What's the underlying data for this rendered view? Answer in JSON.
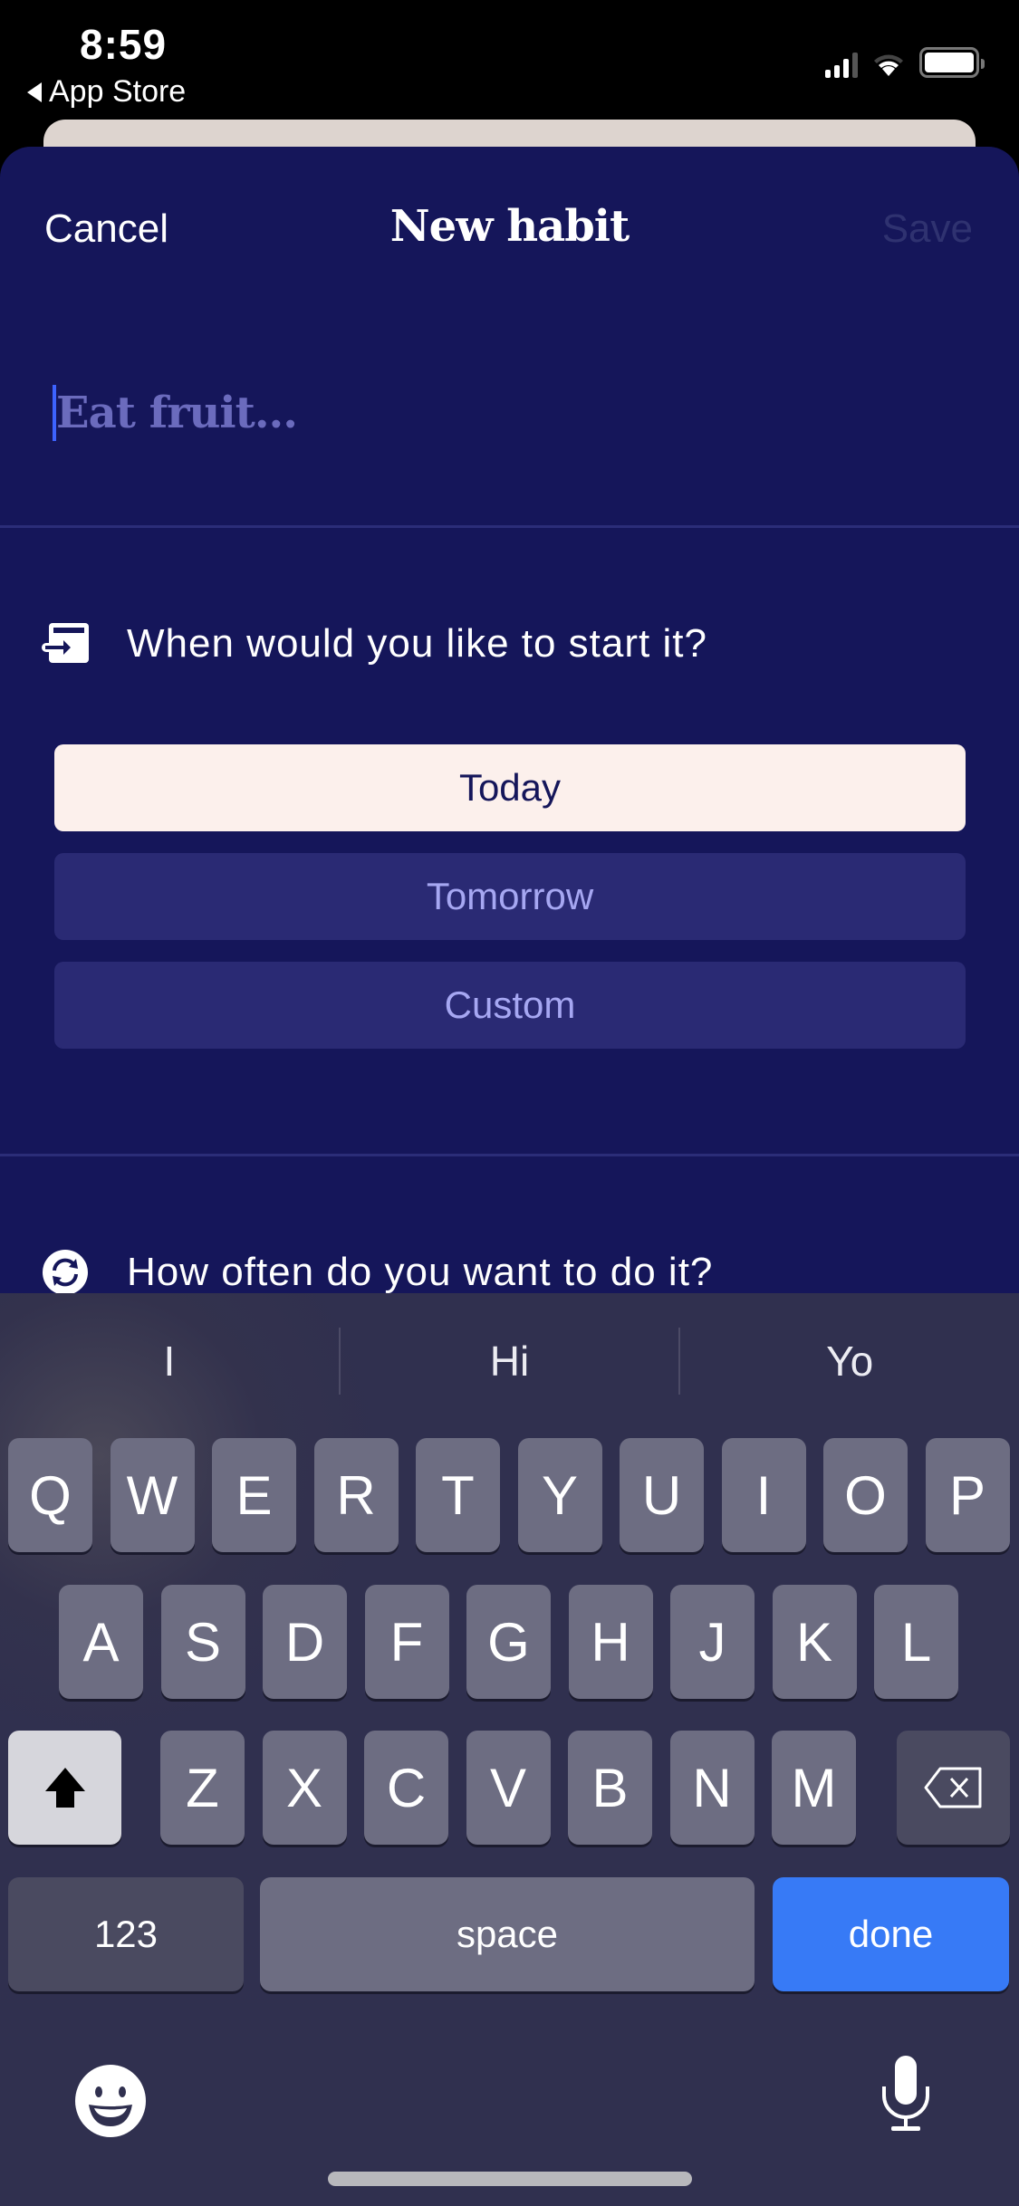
{
  "status_bar": {
    "time": "8:59",
    "back_app": "App Store",
    "icons": [
      "cellular-signal-icon",
      "wifi-icon",
      "battery-icon"
    ]
  },
  "nav": {
    "cancel_label": "Cancel",
    "title": "New habit",
    "save_label": "Save"
  },
  "habit_input": {
    "value": "",
    "placeholder": "Eat fruit..."
  },
  "start_section": {
    "icon": "calendar-arrow-icon",
    "question": "When would you like to start it?",
    "options": [
      {
        "label": "Today",
        "selected": true
      },
      {
        "label": "Tomorrow",
        "selected": false
      },
      {
        "label": "Custom",
        "selected": false
      }
    ]
  },
  "frequency_section": {
    "icon": "repeat-icon",
    "question": "How often do you want to do it?"
  },
  "keyboard": {
    "suggestions": [
      "I",
      "Hi",
      "Yo"
    ],
    "row1": [
      "Q",
      "W",
      "E",
      "R",
      "T",
      "Y",
      "U",
      "I",
      "O",
      "P"
    ],
    "row2": [
      "A",
      "S",
      "D",
      "F",
      "G",
      "H",
      "J",
      "K",
      "L"
    ],
    "row3": [
      "Z",
      "X",
      "C",
      "V",
      "B",
      "N",
      "M"
    ],
    "numbers_label": "123",
    "space_label": "space",
    "done_label": "done",
    "icons": {
      "shift": "shift-icon",
      "delete": "backspace-icon",
      "emoji": "emoji-icon",
      "mic": "microphone-icon"
    }
  },
  "colors": {
    "sheet_bg": "#15165a",
    "selected_option_bg": "#fcf0ec",
    "unselected_option_bg": "#2a2a74",
    "unselected_option_text": "#a6a7f2",
    "done_key": "#377af6"
  }
}
